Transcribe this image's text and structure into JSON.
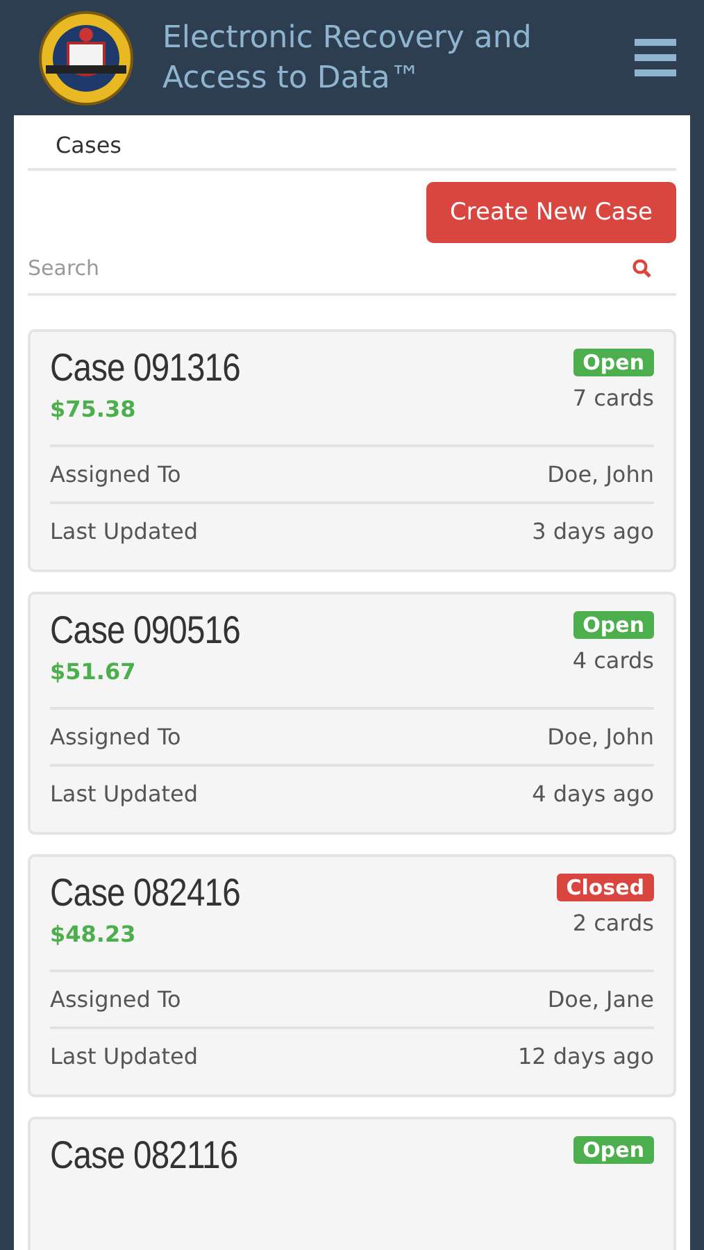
{
  "header": {
    "title": "Electronic Recovery and Access to Data™"
  },
  "breadcrumb": "Cases",
  "create_button": "Create New Case",
  "search": {
    "placeholder": "Search"
  },
  "cases": [
    {
      "title": "Case 091316",
      "status": {
        "label": "Open",
        "kind": "open"
      },
      "amount": "$75.38",
      "cards": "7 cards",
      "rows": [
        {
          "label": "Assigned To",
          "value": "Doe, John"
        },
        {
          "label": "Last Updated",
          "value": "3 days ago"
        }
      ]
    },
    {
      "title": "Case 090516",
      "status": {
        "label": "Open",
        "kind": "open"
      },
      "amount": "$51.67",
      "cards": "4 cards",
      "rows": [
        {
          "label": "Assigned To",
          "value": "Doe, John"
        },
        {
          "label": "Last Updated",
          "value": "4 days ago"
        }
      ]
    },
    {
      "title": "Case 082416",
      "status": {
        "label": "Closed",
        "kind": "closed"
      },
      "amount": "$48.23",
      "cards": "2 cards",
      "rows": [
        {
          "label": "Assigned To",
          "value": "Doe, Jane"
        },
        {
          "label": "Last Updated",
          "value": "12 days ago"
        }
      ]
    },
    {
      "title": "Case 082116",
      "status": {
        "label": "Open",
        "kind": "open"
      }
    }
  ]
}
